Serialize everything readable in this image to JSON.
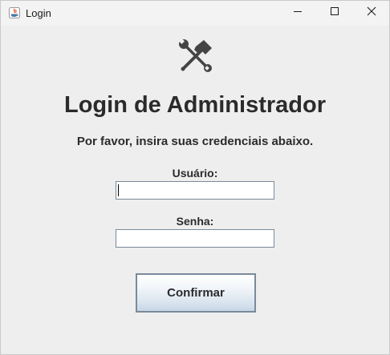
{
  "window": {
    "title": "Login",
    "controls": {
      "minimize": "minimize-icon",
      "maximize": "maximize-icon",
      "close": "close-icon"
    }
  },
  "header": {
    "icon": "tools-icon",
    "title": "Login de Administrador",
    "subtitle": "Por favor, insira suas credenciais abaixo."
  },
  "form": {
    "username_label": "Usuário:",
    "username_value": "",
    "password_label": "Senha:",
    "password_value": "",
    "confirm_label": "Confirmar"
  },
  "colors": {
    "background": "#eeeeee",
    "text": "#2b2b2b",
    "button_border": "#7a8a9c"
  }
}
